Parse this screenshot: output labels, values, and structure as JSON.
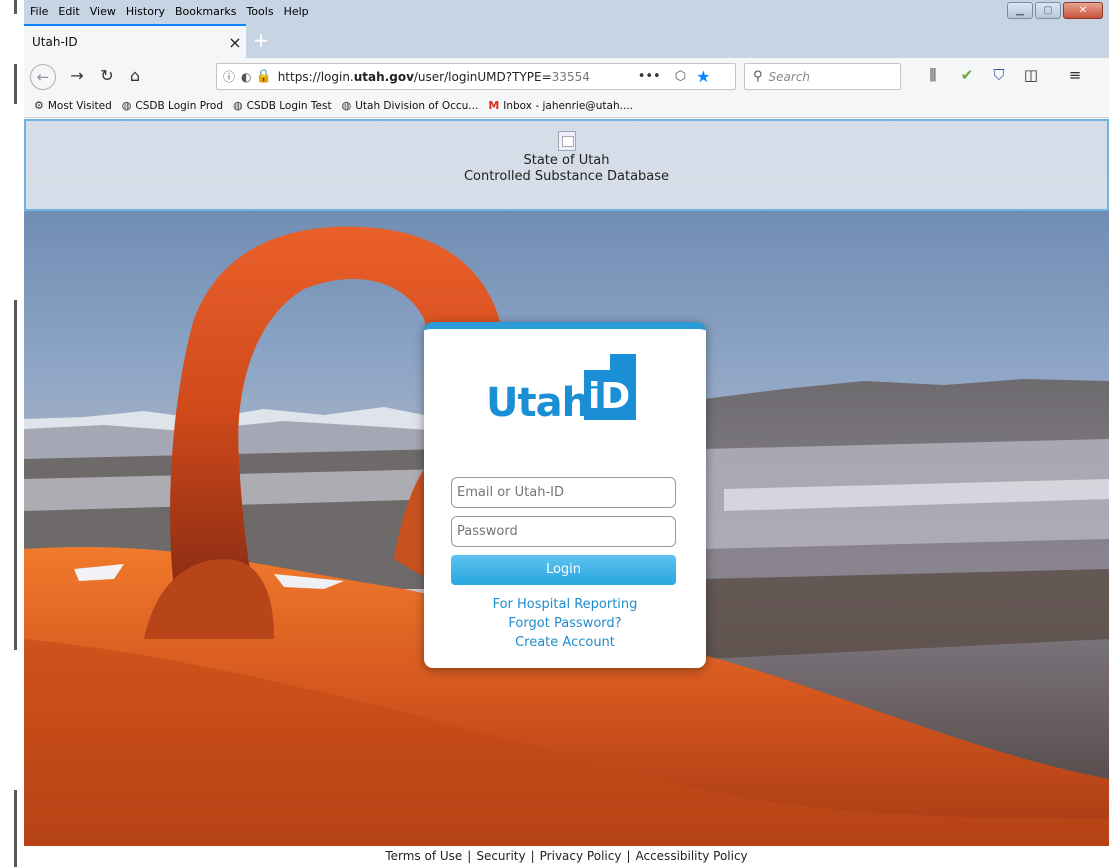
{
  "menu": [
    "File",
    "Edit",
    "View",
    "History",
    "Bookmarks",
    "Tools",
    "Help"
  ],
  "tab": {
    "title": "Utah-ID",
    "close": "×",
    "new": "+"
  },
  "nav": {
    "url_main": "https://login.",
    "url_domain": "utah.gov",
    "url_path": "/user/loginUMD?TYPE=",
    "url_dim": "33554",
    "dots": "•••",
    "search_placeholder": "Search"
  },
  "bookmarks": [
    {
      "icon": "gear-icon",
      "label": "Most Visited"
    },
    {
      "icon": "globe-icon",
      "label": "CSDB Login Prod"
    },
    {
      "icon": "globe-icon",
      "label": "CSDB Login Test"
    },
    {
      "icon": "globe-icon",
      "label": "Utah Division of Occu..."
    },
    {
      "icon": "gmail-icon",
      "label": "Inbox - jahenrie@utah...."
    }
  ],
  "header": {
    "line1": "State of Utah",
    "line2": "Controlled Substance Database"
  },
  "login": {
    "logo_text": "Utah",
    "logo_box_text": "iD",
    "email_placeholder": "Email or Utah-ID",
    "password_placeholder": "Password",
    "button": "Login",
    "links": [
      "For Hospital Reporting",
      "Forgot Password?",
      "Create Account"
    ]
  },
  "footer": [
    "Terms of Use",
    "Security",
    "Privacy Policy",
    "Accessibility Policy"
  ],
  "colors": {
    "accent": "#2b9cd8",
    "link": "#1e8ccc",
    "brand": "#1a8fd6"
  }
}
